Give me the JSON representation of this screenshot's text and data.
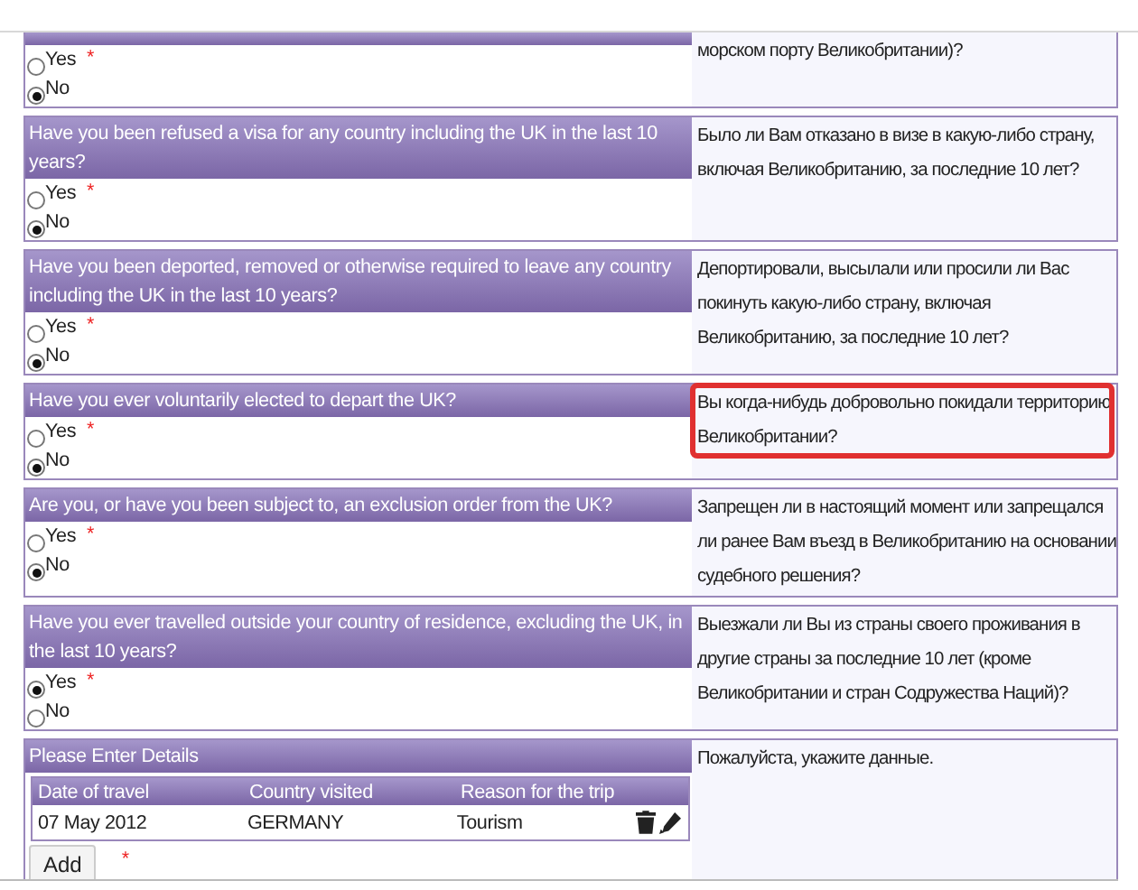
{
  "sections": [
    {
      "translation": "морском порту Великобритании)?",
      "options": [
        {
          "label": "Yes",
          "selected": false,
          "required_mark": "*"
        },
        {
          "label": "No",
          "selected": true
        }
      ]
    },
    {
      "question": "Have you been refused a visa for any country including the UK in the last 10 years?",
      "translation": "Было ли Вам отказано в визе в какую-либо страну, включая Великобританию, за последние 10 лет?",
      "options": [
        {
          "label": "Yes",
          "selected": false,
          "required_mark": "*"
        },
        {
          "label": "No",
          "selected": true
        }
      ]
    },
    {
      "question": "Have you been deported, removed or otherwise required to leave any country including the UK in the last 10 years?",
      "translation": "Депортировали, высылали или просили ли Вас покинуть какую-либо страну, включая Великобританию, за последние 10 лет?",
      "options": [
        {
          "label": "Yes",
          "selected": false,
          "required_mark": "*"
        },
        {
          "label": "No",
          "selected": true
        }
      ]
    },
    {
      "question": "Have you ever voluntarily elected to depart the UK?",
      "translation": "Вы когда-нибудь добровольно покидали территорию Великобритании?",
      "highlighted": true,
      "options": [
        {
          "label": "Yes",
          "selected": false,
          "required_mark": "*"
        },
        {
          "label": "No",
          "selected": true
        }
      ]
    },
    {
      "question": "Are you, or have you been subject to, an exclusion order from the UK?",
      "translation": "Запрещен ли в настоящий момент или запрещался ли ранее Вам въезд в Великобританию на основании судебного решения?",
      "options": [
        {
          "label": "Yes",
          "selected": false,
          "required_mark": "*"
        },
        {
          "label": "No",
          "selected": true
        }
      ]
    },
    {
      "question": "Have you ever travelled outside your country of residence, excluding the UK, in the last 10 years?",
      "translation": "Выезжали ли Вы из страны своего проживания в другие страны за последние 10 лет (кроме Великобритании и стран Содружества Наций)?",
      "options": [
        {
          "label": "Yes",
          "selected": true,
          "required_mark": "*"
        },
        {
          "label": "No",
          "selected": false
        }
      ]
    }
  ],
  "details": {
    "title": "Please Enter Details",
    "translation": "Пожалуйста, укажите данные.",
    "columns": [
      "Date of travel",
      "Country visited",
      "Reason for the trip"
    ],
    "rows": [
      {
        "cells": [
          "07 May 2012",
          "GERMANY",
          "Tourism"
        ]
      }
    ],
    "add_button": "Add",
    "required_mark": "*"
  }
}
